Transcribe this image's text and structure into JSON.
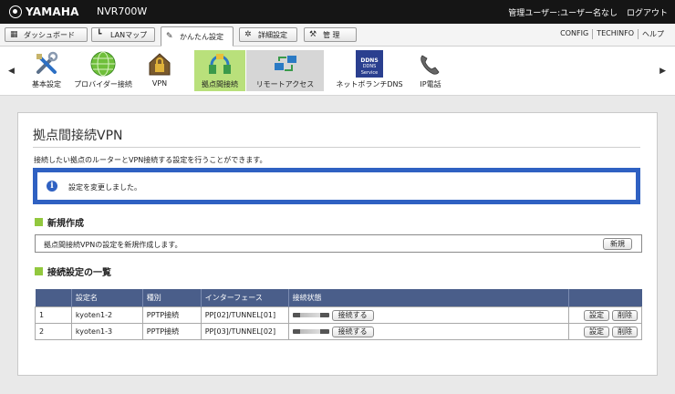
{
  "header": {
    "brand": "YAMAHA",
    "model": "NVR700W",
    "user": "管理ユーザー:ユーザー名なし",
    "logout": "ログアウト"
  },
  "tabs": [
    {
      "label": "ダッシュボード",
      "icon": "dashboard-icon"
    },
    {
      "label": "LANマップ",
      "icon": "lan-map-icon"
    },
    {
      "label": "かんたん設定",
      "icon": "wand-icon",
      "active": true
    },
    {
      "label": "詳細設定",
      "icon": "gear-icon"
    },
    {
      "label": "管 理",
      "icon": "wrench-icon"
    }
  ],
  "tab_links": [
    "CONFIG",
    "TECHINFO",
    "ヘルプ"
  ],
  "strip": [
    {
      "label": "基本設定",
      "icon": "tools-icon"
    },
    {
      "label": "プロバイダー接続",
      "icon": "globe-icon"
    },
    {
      "label": "VPN",
      "icon": "lock-house-icon"
    },
    {
      "label": "拠点間接続",
      "icon": "site-connect-icon",
      "selected": true
    },
    {
      "label": "リモートアクセス",
      "icon": "remote-access-icon",
      "hover": true
    },
    {
      "label": "ネットボランチDNS",
      "icon": "ddns-icon",
      "sub": "DDNS Service"
    },
    {
      "label": "IP電話",
      "icon": "phone-icon"
    }
  ],
  "page": {
    "title": "拠点間接続VPN",
    "description": "接続したい拠点のルーターとVPN接続する設定を行うことができます。",
    "notice": "設定を変更しました。",
    "new_section": {
      "title": "新規作成",
      "text": "拠点間接続VPNの設定を新規作成します。",
      "button": "新規"
    },
    "list_section": {
      "title": "接続設定の一覧"
    }
  },
  "table": {
    "headers": [
      "",
      "設定名",
      "種別",
      "インターフェース",
      "接続状態",
      ""
    ],
    "rows": [
      {
        "no": "1",
        "name": "kyoten1-2",
        "type": "PPTP接続",
        "iface": "PP[02]/TUNNEL[01]",
        "connect": "接続する",
        "edit": "設定",
        "delete": "削除"
      },
      {
        "no": "2",
        "name": "kyoten1-3",
        "type": "PPTP接続",
        "iface": "PP[03]/TUNNEL[02]",
        "connect": "接続する",
        "edit": "設定",
        "delete": "削除"
      }
    ]
  },
  "colors": {
    "topbar": "#151515",
    "accent_blue": "#2f61c2",
    "header_row": "#4a5e8a",
    "green": "#92c83e",
    "selected_bg": "#b9e07b"
  }
}
